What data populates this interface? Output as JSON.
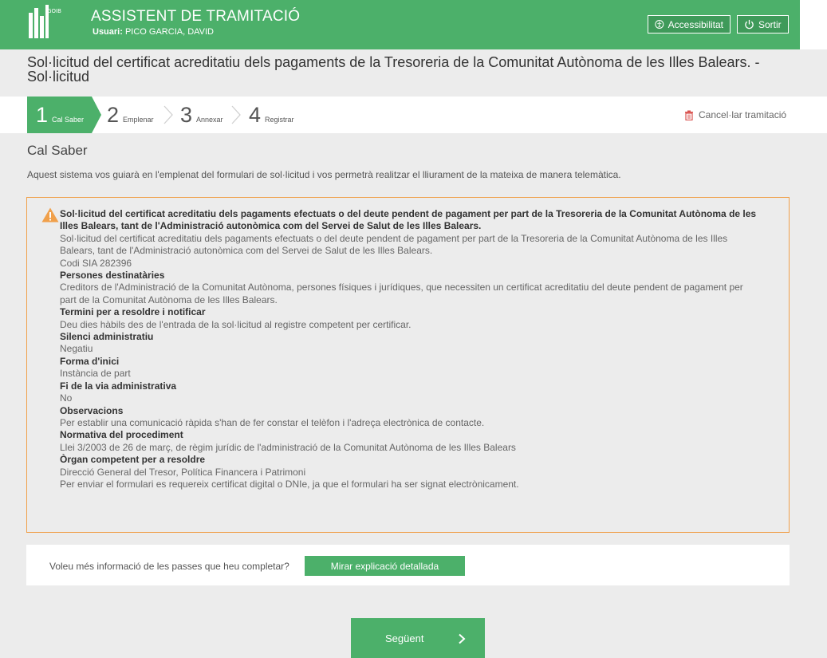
{
  "header": {
    "app_title": "ASSISTENT DE TRAMITACIÓ",
    "user_label": "Usuari:",
    "user_name": "PICO GARCIA, DAVID",
    "accessibility_label": "Accessibilitat",
    "exit_label": "Sortir",
    "logo_letters": "GOIB"
  },
  "page_title": "Sol·licitud del certificat acreditatiu dels pagaments de la Tresoreria de la Comunitat Autònoma de les Illes Balears. - Sol·licitud",
  "steps": [
    {
      "num": "1",
      "label": "Cal Saber"
    },
    {
      "num": "2",
      "label": "Emplenar"
    },
    {
      "num": "3",
      "label": "Annexar"
    },
    {
      "num": "4",
      "label": "Registrar"
    }
  ],
  "cancel_label": "Cancel·lar tramitació",
  "section_title": "Cal Saber",
  "intro": "Aquest sistema vos guiarà en l'emplenat del formulari de sol·licitud i vos permetrà realitzar el lliurament de la mateixa de manera telemàtica.",
  "info": {
    "heading": "Sol·licitud del certificat acreditatiu dels pagaments efectuats o del deute pendent de pagament per part de la Tresoreria de la Comunitat Autònoma de les Illes Balears, tant de l'Administració autonòmica com del Servei de Salut de les Illes Balears.",
    "description": "Sol·licitud del certificat acreditatiu dels pagaments efectuats o del deute pendent de pagament per part de la Tresoreria de la Comunitat Autònoma de les Illes Balears, tant de l'Administració autonòmica com del Servei de Salut de les Illes Balears.",
    "code": "Codi SIA 282396",
    "sections": [
      {
        "title": "Persones destinatàries",
        "text": "Creditors de l'Administració de la Comunitat Autònoma, persones físiques i jurídiques, que necessiten un certificat acreditatiu del deute pendent de pagament per part de la Comunitat Autònoma de les Illes Balears."
      },
      {
        "title": "Termini per a resoldre i notificar",
        "text": "Deu dies hàbils des de l'entrada de la sol·licitud al registre competent per certificar."
      },
      {
        "title": "Silenci administratiu",
        "text": "Negatiu"
      },
      {
        "title": "Forma d'inici",
        "text": "Instància de part"
      },
      {
        "title": "Fi de la via administrativa",
        "text": "No"
      },
      {
        "title": "Observacions",
        "text": "Per establir una comunicació ràpida s'han de fer constar el telèfon i l'adreça electrònica de contacte."
      },
      {
        "title": "Normativa del procediment",
        "text": "Llei 3/2003 de 26 de març, de règim jurídic de l'administració de la Comunitat Autònoma de les Illes Balears"
      },
      {
        "title": "Òrgan competent per a resoldre",
        "text": "Direcció General del Tresor, Política Financera i Patrimoni"
      }
    ],
    "footer": "Per enviar el formulari es requereix certificat digital o DNIe, ja que el formulari ha ser signat electrònicament."
  },
  "more_info": {
    "question": "Voleu més informació de les passes que heu completar?",
    "button_label": "Mirar explicació detallada"
  },
  "next_label": "Següent",
  "colors": {
    "brand_green": "#4cb06a",
    "warning_orange": "#f0a04b"
  }
}
